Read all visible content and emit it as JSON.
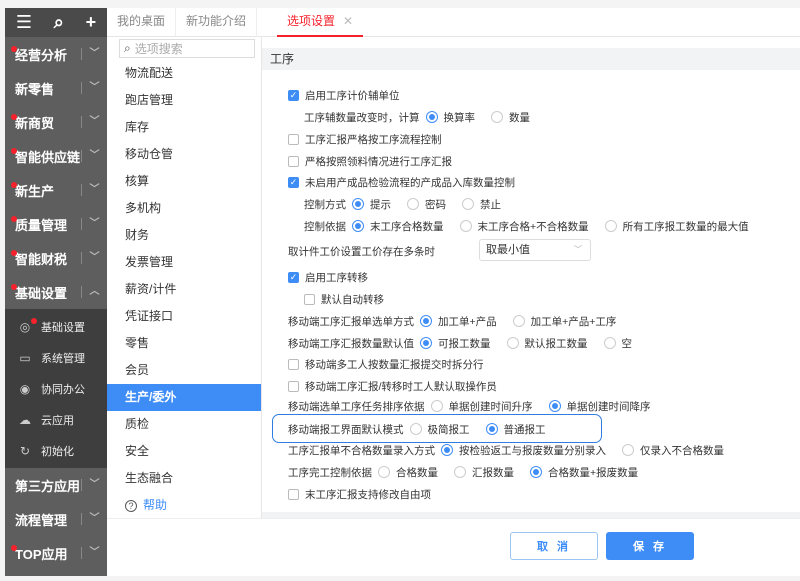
{
  "sidebar": {
    "top_icons": [
      "menu-icon",
      "search-icon",
      "plus-icon"
    ],
    "items": [
      {
        "label": "经营分析",
        "dot": true,
        "expanded": false
      },
      {
        "label": "新零售",
        "dot": false,
        "expanded": false
      },
      {
        "label": "新商贸",
        "dot": true,
        "expanded": false
      },
      {
        "label": "智能供应链",
        "dot": true,
        "expanded": false
      },
      {
        "label": "新生产",
        "dot": true,
        "expanded": false
      },
      {
        "label": "质量管理",
        "dot": true,
        "expanded": false
      },
      {
        "label": "智能财税",
        "dot": true,
        "expanded": false
      },
      {
        "label": "基础设置",
        "dot": true,
        "expanded": true
      }
    ],
    "submenu": [
      {
        "label": "基础设置",
        "icon": "settings-icon",
        "dot": true
      },
      {
        "label": "系统管理",
        "icon": "monitor-icon",
        "dot": false
      },
      {
        "label": "协同办公",
        "icon": "collab-icon",
        "dot": false
      },
      {
        "label": "云应用",
        "icon": "cloud-icon",
        "dot": false
      },
      {
        "label": "初始化",
        "icon": "reset-icon",
        "dot": false
      }
    ],
    "items_after": [
      {
        "label": "第三方应用",
        "dot": false
      },
      {
        "label": "流程管理",
        "dot": false
      },
      {
        "label": "TOP应用",
        "dot": true
      }
    ]
  },
  "tabs": [
    {
      "label": "我的桌面"
    },
    {
      "label": "新功能介绍"
    },
    {
      "label": "选项设置",
      "active": true
    }
  ],
  "mid": {
    "search_placeholder": "选项搜索",
    "items": [
      "物流配送",
      "跑店管理",
      "库存",
      "移动仓管",
      "核算",
      "多机构",
      "财务",
      "发票管理",
      "薪资/计件",
      "凭证接口",
      "零售",
      "会员",
      "生产/委外",
      "质检",
      "安全",
      "生态融合"
    ],
    "active": "生产/委外",
    "help": "帮助"
  },
  "content": {
    "section_title": "工序",
    "rows": [
      {
        "type": "checkbox",
        "label": "启用工序计价辅单位",
        "checked": true
      },
      {
        "type": "radio",
        "indent": true,
        "label": "工序辅数量改变时，计算",
        "options": [
          "换算率",
          "数量"
        ],
        "selected": 0
      },
      {
        "type": "checkbox",
        "label": "工序汇报严格按工序流程控制",
        "checked": false
      },
      {
        "type": "checkbox",
        "label": "严格按照领料情况进行工序汇报",
        "checked": false
      },
      {
        "type": "checkbox",
        "label": "未启用产成品检验流程的产成品入库数量控制",
        "checked": true
      },
      {
        "type": "radio",
        "indent": true,
        "label": "控制方式",
        "options": [
          "提示",
          "密码",
          "禁止"
        ],
        "selected": 0
      },
      {
        "type": "radio",
        "indent": true,
        "label": "控制依据",
        "options": [
          "末工序合格数量",
          "末工序合格+不合格数量",
          "所有工序报工数量的最大值"
        ],
        "selected": 0
      },
      {
        "type": "select",
        "label": "取计件工价设置工价存在多条时",
        "value": "取最小值"
      },
      {
        "type": "checkbox",
        "label": "启用工序转移",
        "checked": true
      },
      {
        "type": "checkbox",
        "indent": true,
        "label": "默认自动转移",
        "checked": false
      },
      {
        "type": "radio",
        "label": "移动端工序汇报单选单方式",
        "options": [
          "加工单+产品",
          "加工单+产品+工序"
        ],
        "selected": 0
      },
      {
        "type": "radio",
        "label": "移动端工序汇报数量默认值",
        "options": [
          "可报工数量",
          "默认报工数量",
          "空"
        ],
        "selected": 0
      },
      {
        "type": "checkbox",
        "label": "移动端多工人按数量汇报提交时拆分行",
        "checked": false
      },
      {
        "type": "checkbox",
        "label": "移动端工序汇报/转移时工人默认取操作员",
        "checked": false
      },
      {
        "type": "radio",
        "label": "移动端选单工序任务排序依据",
        "options": [
          "单据创建时间升序",
          "单据创建时间降序"
        ],
        "selected": 1
      },
      {
        "type": "radio",
        "label": "移动端报工界面默认模式",
        "options": [
          "极简报工",
          "普通报工"
        ],
        "selected": 1,
        "highlighted": true
      },
      {
        "type": "radio",
        "label": "工序汇报单不合格数量录入方式",
        "options": [
          "按检验返工与报废数量分别录入",
          "仅录入不合格数量"
        ],
        "selected": 0
      },
      {
        "type": "radio",
        "label": "工序完工控制依据",
        "options": [
          "合格数量",
          "汇报数量",
          "合格数量+报废数量"
        ],
        "selected": 2
      },
      {
        "type": "checkbox",
        "label": "末工序汇报支持修改自由项",
        "checked": false
      }
    ]
  },
  "footer": {
    "cancel": "取 消",
    "save": "保 存"
  },
  "colors": {
    "accent": "#3e8df7",
    "sidebar": "#5f5e5e",
    "active_tab": "#f5222d"
  }
}
